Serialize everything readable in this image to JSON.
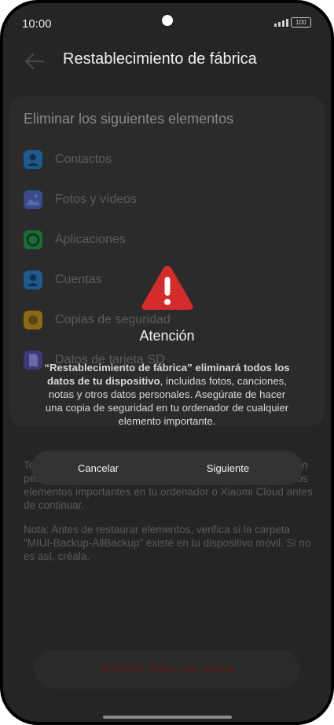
{
  "status_bar": {
    "time": "10:00",
    "battery": "100"
  },
  "header": {
    "title": "Restablecimiento de fábrica"
  },
  "section": {
    "title": "Eliminar los siguientes elementos",
    "items": [
      {
        "label": "Contactos",
        "icon": "contacts-icon",
        "color": "#1f5a8f"
      },
      {
        "label": "Fotos y vídeos",
        "icon": "gallery-icon",
        "color": "#3a4a8c"
      },
      {
        "label": "Aplicaciones",
        "icon": "apps-icon",
        "color": "#1e6b37"
      },
      {
        "label": "Cuentas",
        "icon": "accounts-icon",
        "color": "#1f5a8f"
      },
      {
        "label": "Copias de seguridad",
        "icon": "backup-icon",
        "color": "#8a6a1a"
      },
      {
        "label": "Datos de tarjeta SD",
        "icon": "sd-card-icon",
        "color": "#3a3a7a"
      }
    ]
  },
  "notes": {
    "paragraph1": "Todos los elementos enumerados anteriormente se borrarán permanentemente. Haz una copia de seguridad de todos los elementos importantes en tu ordenador o Xiaomi Cloud antes de continuar.",
    "paragraph2": "Nota: Antes de restaurar elementos, verifica si la carpeta \"MIUI-Backup-AllBackup\" existe en tu dispositivo móvil. Si no es así, créala."
  },
  "delete_button": {
    "label": "Eliminar todos los datos"
  },
  "dialog": {
    "title": "Atención",
    "message_bold": "“Restablecimiento de fábrica” eliminará todos los datos de tu dispositivo",
    "message_rest": ", incluidas fotos, canciones, notas y otros datos personales. Asegúrate de hacer una copia de seguridad en tu ordenador de cualquier elemento importante.",
    "cancel": "Cancelar",
    "next": "Siguiente",
    "warning_color": "#d62b2b"
  }
}
